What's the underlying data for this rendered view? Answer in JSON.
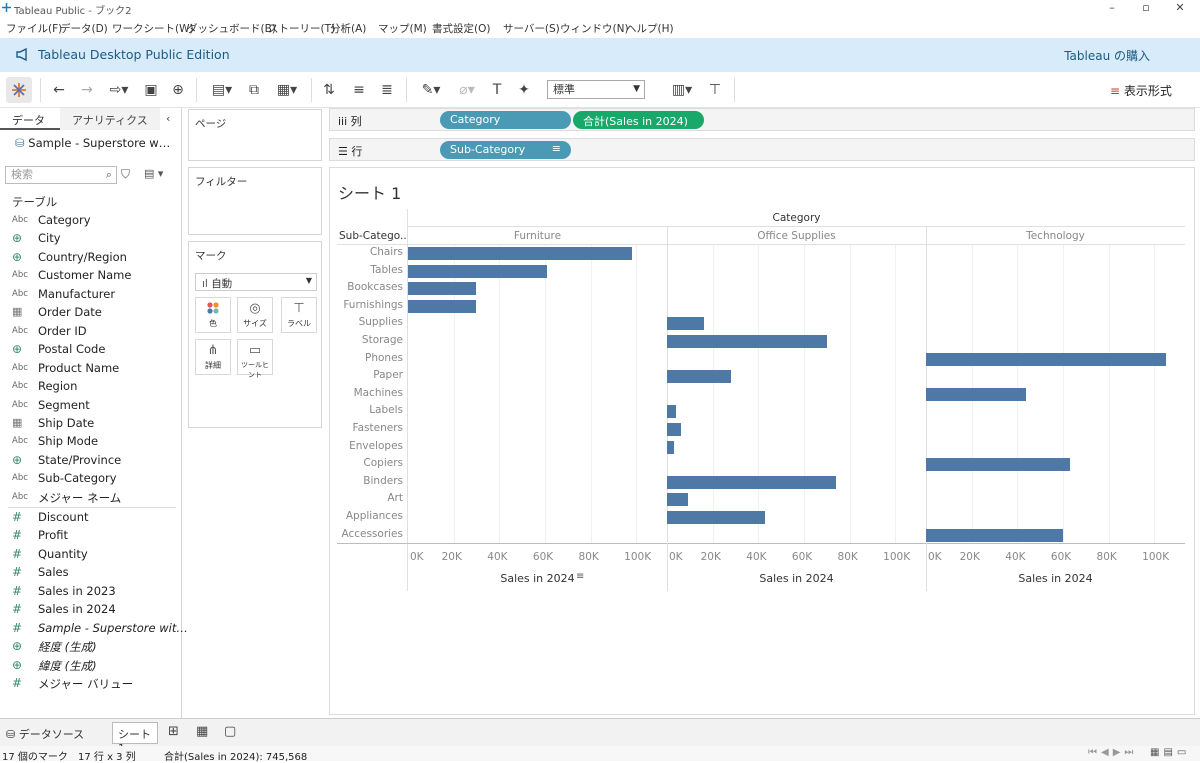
{
  "window": {
    "title": "Tableau Public - ブック2"
  },
  "menu": [
    "ファイル(F)",
    "データ(D)",
    "ワークシート(W)",
    "ダッシュボード(B)",
    "ストーリー(T)",
    "分析(A)",
    "マップ(M)",
    "書式設定(O)",
    "サーバー(S)",
    "ウィンドウ(N)",
    "ヘルプ(H)"
  ],
  "banner": {
    "text": "Tableau Desktop Public Edition",
    "buy": "Tableau の購入"
  },
  "toolbar": {
    "fit_select": "標準",
    "show_me": "表示形式"
  },
  "data_pane": {
    "tab_data": "データ",
    "tab_analytics": "アナリティクス",
    "datasource": "Sample - Superstore w…",
    "search_placeholder": "検索",
    "table_header": "テーブル",
    "dimensions": [
      {
        "icon": "Abc",
        "name": "Category"
      },
      {
        "icon": "globe",
        "name": "City"
      },
      {
        "icon": "globe",
        "name": "Country/Region"
      },
      {
        "icon": "Abc",
        "name": "Customer Name"
      },
      {
        "icon": "Abc",
        "name": "Manufacturer"
      },
      {
        "icon": "cal",
        "name": "Order Date"
      },
      {
        "icon": "Abc",
        "name": "Order ID"
      },
      {
        "icon": "globe",
        "name": "Postal Code"
      },
      {
        "icon": "Abc",
        "name": "Product Name"
      },
      {
        "icon": "Abc",
        "name": "Region"
      },
      {
        "icon": "Abc",
        "name": "Segment"
      },
      {
        "icon": "cal",
        "name": "Ship Date"
      },
      {
        "icon": "Abc",
        "name": "Ship Mode"
      },
      {
        "icon": "globe",
        "name": "State/Province"
      },
      {
        "icon": "Abc",
        "name": "Sub-Category"
      },
      {
        "icon": "Abc",
        "name": "メジャー ネーム"
      }
    ],
    "measures": [
      {
        "icon": "hash",
        "name": "Discount"
      },
      {
        "icon": "hash",
        "name": "Profit"
      },
      {
        "icon": "hash",
        "name": "Quantity"
      },
      {
        "icon": "hash",
        "name": "Sales"
      },
      {
        "icon": "hash",
        "name": "Sales in 2023"
      },
      {
        "icon": "hash",
        "name": "Sales in 2024"
      },
      {
        "icon": "hash",
        "name": "Sample - Superstore wit…"
      },
      {
        "icon": "globe",
        "name": "経度 (生成)"
      },
      {
        "icon": "globe",
        "name": "緯度 (生成)"
      },
      {
        "icon": "hash",
        "name": "メジャー バリュー"
      }
    ]
  },
  "cards": {
    "pages": "ページ",
    "filters": "フィルター",
    "marks": "マーク",
    "mark_type": "自動",
    "buttons": [
      "色",
      "サイズ",
      "ラベル",
      "詳細",
      "ツールヒント"
    ]
  },
  "shelves": {
    "columns_label": "列",
    "rows_label": "行",
    "columns_pills": [
      "Category",
      "合計(Sales in 2024)"
    ],
    "rows_pills": [
      "Sub-Category"
    ]
  },
  "sheet": {
    "title": "シート 1"
  },
  "chart_data": {
    "type": "bar",
    "orientation": "horizontal",
    "column_header_title": "Category",
    "row_header_title": "Sub-Catego..",
    "panels": [
      "Furniture",
      "Office Supplies",
      "Technology"
    ],
    "categories": [
      "Chairs",
      "Tables",
      "Bookcases",
      "Furnishings",
      "Supplies",
      "Storage",
      "Phones",
      "Paper",
      "Machines",
      "Labels",
      "Fasteners",
      "Envelopes",
      "Copiers",
      "Binders",
      "Art",
      "Appliances",
      "Accessories"
    ],
    "category_panel": [
      "Furniture",
      "Furniture",
      "Furniture",
      "Furniture",
      "Office Supplies",
      "Office Supplies",
      "Technology",
      "Office Supplies",
      "Technology",
      "Office Supplies",
      "Office Supplies",
      "Office Supplies",
      "Technology",
      "Office Supplies",
      "Office Supplies",
      "Office Supplies",
      "Technology"
    ],
    "values": [
      98000,
      61000,
      30000,
      30000,
      16000,
      70000,
      105000,
      28000,
      44000,
      4000,
      6000,
      3000,
      63000,
      74000,
      9000,
      43000,
      60000
    ],
    "xticks": [
      "0K",
      "20K",
      "40K",
      "60K",
      "80K",
      "100K"
    ],
    "xlim": [
      0,
      110000
    ],
    "xlabel": "Sales in 2024",
    "color": "#4e79a7"
  },
  "bottom": {
    "datasource_tab": "データソース",
    "sheet_tab": "シート 1"
  },
  "status": {
    "marks": "17 個のマーク",
    "rows_cols": "17 行 x 3 列",
    "sum": "合計(Sales in 2024): 745,568"
  }
}
